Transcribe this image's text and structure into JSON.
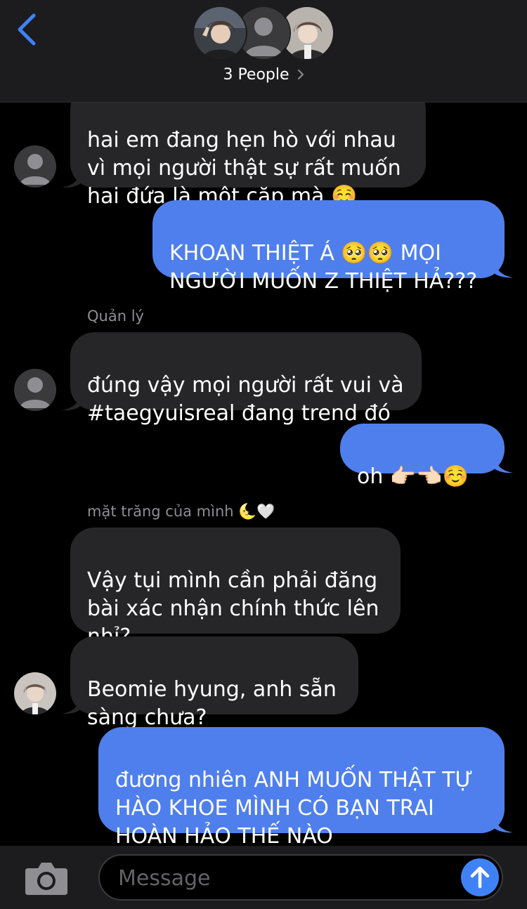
{
  "header": {
    "people_label": "3 People"
  },
  "messages": [
    {
      "type": "received",
      "text": "hai em đang hẹn hò với nhau\nvì mọi người thật sự rất muốn\nhai đứa là một cặp mà ☺️"
    },
    {
      "type": "sent",
      "text": "KHOAN THIỆT Á 🥺🥺 MỌI\nNGƯỜI MUỐN Z THIỆT HẢ???"
    },
    {
      "type": "received",
      "sender": "Quản lý",
      "text": "đúng vậy mọi người rất vui và\n#taegyuisreal đang trend đó"
    },
    {
      "type": "sent",
      "text": "oh 👉🏻👈🏻☺️"
    },
    {
      "type": "received",
      "sender": "mặt trăng của mình 🌜🤍",
      "text": "Vậy tụi mình cần phải đăng\nbài xác nhận chính thức lên\nnhỉ?"
    },
    {
      "type": "received",
      "text": "Beomie hyung, anh sẵn\nsàng chưa?"
    },
    {
      "type": "sent",
      "text": "đương nhiên ANH MUỐN THẬT TỰ\nHÀO KHOE MÌNH CÓ BẠN TRAI\nHOÀN HẢO THẾ NÀO"
    }
  ],
  "composer": {
    "placeholder": "Message"
  },
  "icons": {
    "back": "chevron-left-icon",
    "camera": "camera-icon",
    "send": "arrow-up-icon",
    "people_chevron": "chevron-right-icon"
  },
  "colors": {
    "sent_bubble": "#4f7fec",
    "received_bubble": "#262628",
    "accent": "#3f82f6",
    "header_bg": "#1c1c1e"
  }
}
